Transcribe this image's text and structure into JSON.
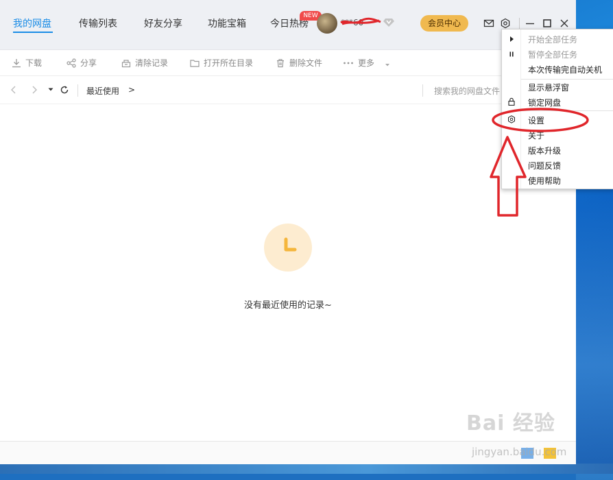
{
  "nav": {
    "tabs": [
      {
        "label": "我的网盘"
      },
      {
        "label": "传输列表"
      },
      {
        "label": "好友分享"
      },
      {
        "label": "功能宝箱"
      },
      {
        "label": "今日热榜"
      }
    ],
    "new_badge": "NEW",
    "username": "***60",
    "vip_label": "会员中心"
  },
  "toolbar": {
    "download": "下载",
    "share": "分享",
    "clear": "清除记录",
    "open_dir": "打开所在目录",
    "delete": "删除文件",
    "more": "更多"
  },
  "pathbar": {
    "crumb": "最近使用",
    "crumb_arrow": ">",
    "search_placeholder": "搜索我的网盘文件"
  },
  "empty": {
    "message": "没有最近使用的记录~"
  },
  "menu": {
    "items": [
      {
        "label": "开始全部任务",
        "disabled": true,
        "icon": "play-icon"
      },
      {
        "label": "暂停全部任务",
        "disabled": true,
        "icon": "pause-icon"
      },
      {
        "label": "本次传输完自动关机",
        "disabled": false
      },
      {
        "label": "显示悬浮窗",
        "disabled": false
      },
      {
        "label": "锁定网盘",
        "disabled": false,
        "icon": "lock-icon"
      },
      {
        "label": "设置",
        "disabled": false,
        "icon": "gear-icon"
      },
      {
        "label": "关于",
        "disabled": false
      },
      {
        "label": "版本升级",
        "disabled": false
      },
      {
        "label": "问题反馈",
        "disabled": false
      },
      {
        "label": "使用帮助",
        "disabled": false
      }
    ]
  },
  "watermark": {
    "brand": "Bai 经验",
    "url": "jingyan.baidu.com"
  },
  "colors": {
    "accent": "#1a8ce6",
    "vip": "#f0b94f",
    "annotation": "#e0262b",
    "badge": "#f04a4a"
  }
}
